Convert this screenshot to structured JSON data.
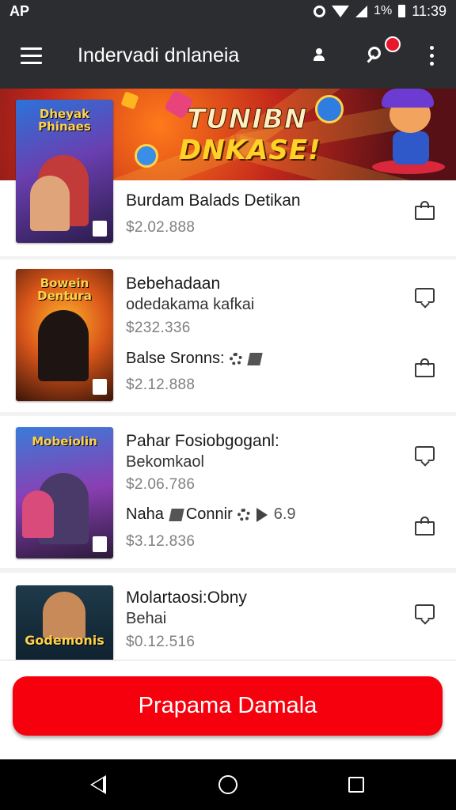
{
  "status_bar": {
    "carrier": "AP",
    "battery": "1%",
    "time": "11:39"
  },
  "app_bar": {
    "title": "Indervadi dnlaneia",
    "icons": [
      "menu-icon",
      "person-icon",
      "search-user-icon",
      "more-vert-icon"
    ]
  },
  "banner": {
    "line1": "TUNIBN",
    "line2": "DNKASE!"
  },
  "products": [
    {
      "cover_title": "Dheyak Phinaes",
      "title": "Burdam Balads Detikan",
      "price": "$2.02.888"
    },
    {
      "cover_title": "Bowein Dentura",
      "title": "Bebehadaan",
      "subtitle": "odedakama kafkai",
      "price": "$232.336",
      "variant_title": "Balse Sronns:",
      "variant_price": "$2.12.888"
    },
    {
      "cover_title": "Mobeiolin",
      "title": "Pahar Fosiobgoganl:",
      "subtitle": "Bekomkaol",
      "price": "$2.06.786",
      "variant_title": "Naha",
      "variant_extra": "Connir",
      "variant_note": "6.9",
      "variant_price": "$3.12.836"
    },
    {
      "cover_title": "Godemonis",
      "title": "Molartaosi:Obny",
      "subtitle": "Behai",
      "price": "$0.12.516"
    }
  ],
  "cta": {
    "label": "Prapama Damala"
  },
  "colors": {
    "app_bar": "#2b2d30",
    "cta": "#f7000d",
    "price": "#808080"
  }
}
